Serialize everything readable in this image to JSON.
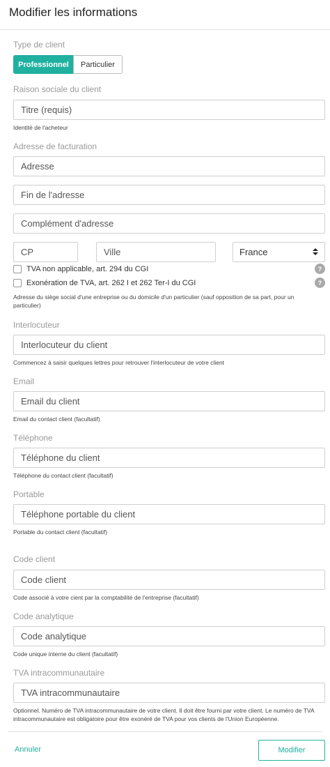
{
  "header": {
    "title": "Modifier les informations"
  },
  "client_type": {
    "label": "Type de client",
    "options": [
      "Professionnel",
      "Particulier"
    ]
  },
  "raison_sociale": {
    "label": "Raison sociale du client",
    "placeholder": "Titre (requis)",
    "help": "Identité de l'acheteur"
  },
  "adresse": {
    "label": "Adresse de facturation",
    "line1_placeholder": "Adresse",
    "line2_placeholder": "Fin de l'adresse",
    "line3_placeholder": "Complément d'adresse",
    "cp_placeholder": "CP",
    "ville_placeholder": "Ville",
    "country_value": "France",
    "country_icon": "sort-arrows-icon",
    "tva_na_label": "TVA non applicable, art. 294 du CGI",
    "exoneration_label": "Exonération de TVA, art. 262 I et 262 Ter-I du CGI",
    "help_icon_text": "?",
    "help": "Adresse du siège social d'une entreprise ou du domicile d'un particulier (sauf opposition de sa part, pour un particulier)"
  },
  "interlocuteur": {
    "label": "Interlocuteur",
    "placeholder": "Interlocuteur du client",
    "help": "Commencez à saisir quelques lettres pour retrouver l'interlocuteur de votre client"
  },
  "email": {
    "label": "Email",
    "placeholder": "Email du client",
    "help": "Email du contact client (facultatif)"
  },
  "telephone": {
    "label": "Téléphone",
    "placeholder": "Téléphone du client",
    "help": "Téléphone du contact client (facultatif)"
  },
  "portable": {
    "label": "Portable",
    "placeholder": "Téléphone portable du client",
    "help": "Portable du contact client (facultatif)"
  },
  "code_client": {
    "label": "Code client",
    "placeholder": "Code client",
    "help": "Code associé à votre cient par la comptabilité de l'entreprise (facultatif)"
  },
  "code_analytique": {
    "label": "Code analytique",
    "placeholder": "Code analytique",
    "help": "Code unique interne du client (facultatif)"
  },
  "tva_intra": {
    "label": "TVA intracommunautaire",
    "placeholder": "TVA intracommunautaire",
    "help": "Optionnel. Numéro de TVA intracommunautaire de votre client. Il doit être fourni par votre client. Le numéro de TVA intracommunautaire est obligatoire pour être exonéré de TVA pour vos clients de l'Union Européenne."
  },
  "footer": {
    "cancel_label": "Annuler",
    "submit_label": "Modifier"
  },
  "colors": {
    "accent": "#1fb0a0",
    "border": "#cfcfcf",
    "label": "#999999"
  }
}
